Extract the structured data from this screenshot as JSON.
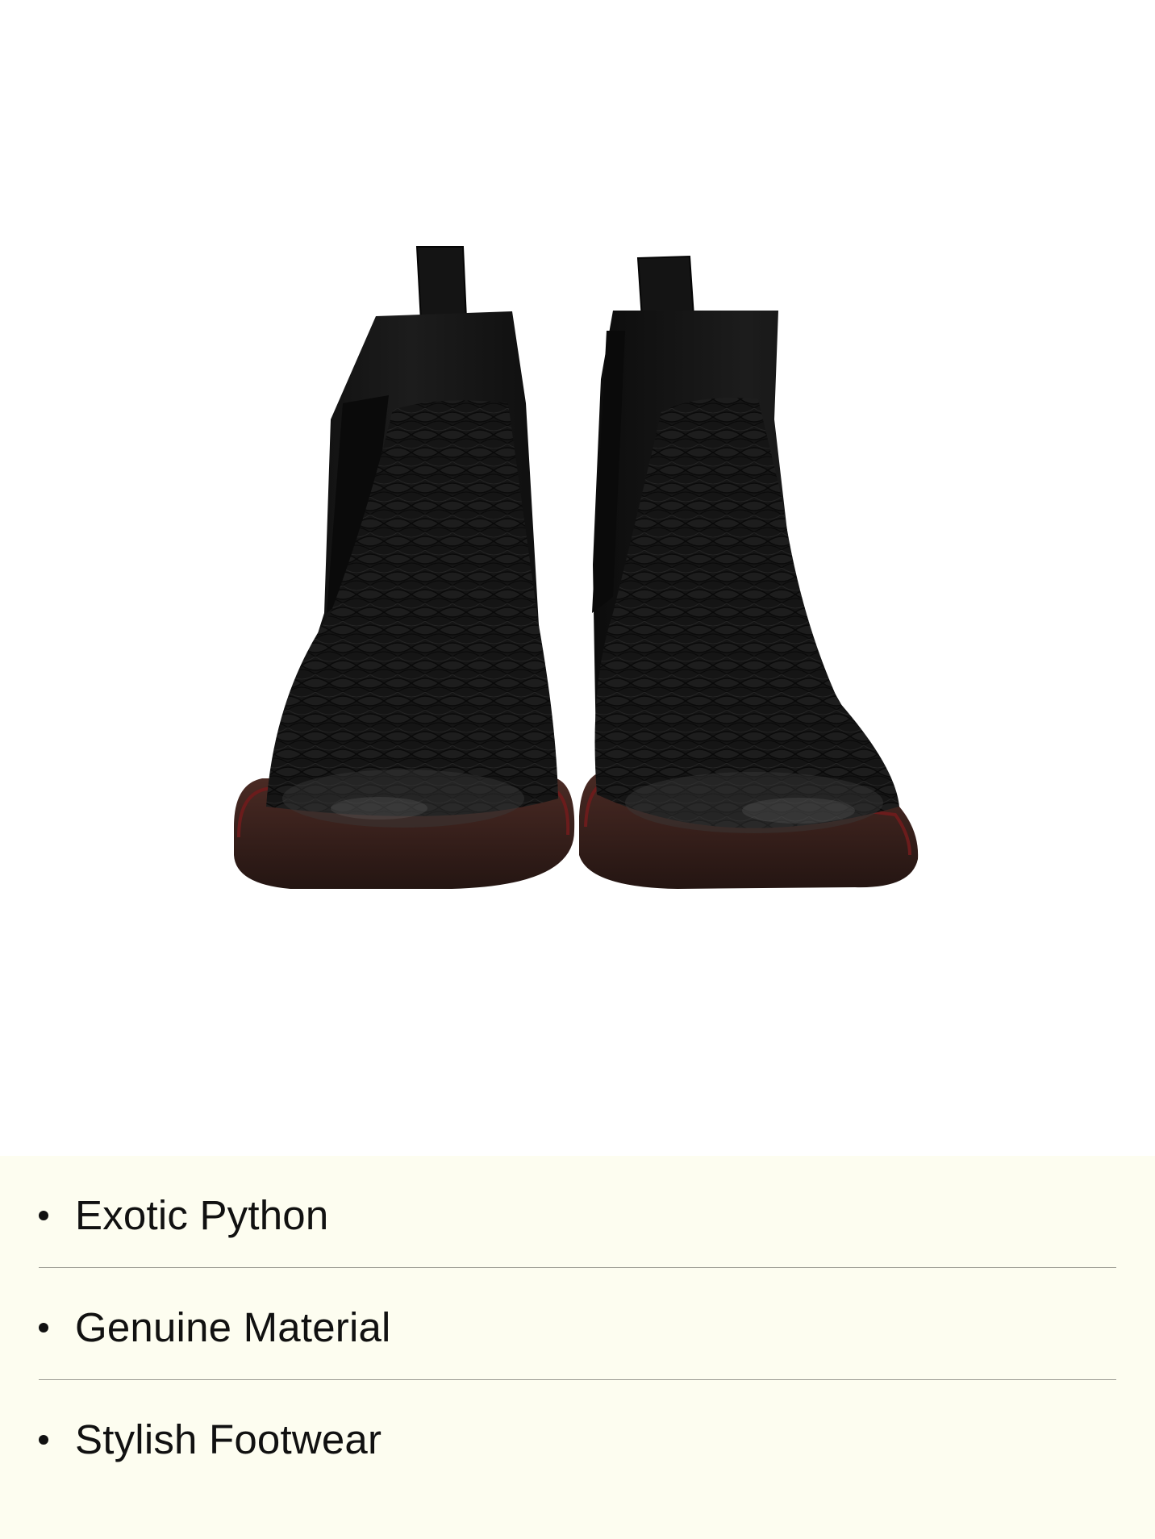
{
  "product_image": {
    "subject": "black-python-chelsea-boots-pair",
    "icon": "boots-photo",
    "colors": {
      "boot": "#141414",
      "scales": "#1f1f1f",
      "sole": "#3a2420",
      "welt": "#5a1a1a"
    }
  },
  "features": {
    "items": [
      {
        "label": "Exotic Python"
      },
      {
        "label": "Genuine Material"
      },
      {
        "label": "Stylish Footwear"
      }
    ]
  },
  "theme": {
    "panel_background": "#fdfdf0",
    "divider": "#9a9a92",
    "text": "#111111"
  }
}
